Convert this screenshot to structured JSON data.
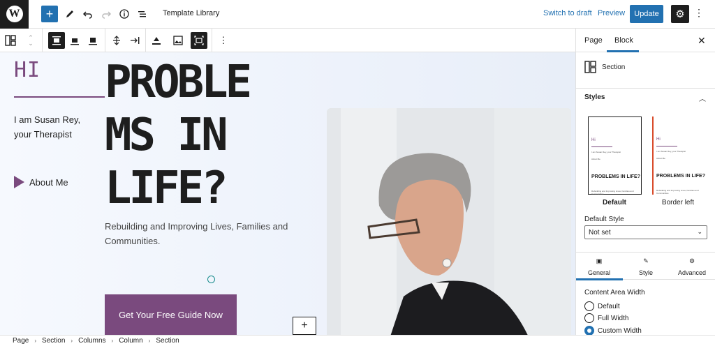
{
  "topbar": {
    "title": "Template Library",
    "switch_to_draft": "Switch to draft",
    "preview": "Preview",
    "update": "Update"
  },
  "canvas": {
    "hi": "HI",
    "intro": "I am Susan Rey,  your Therapist",
    "about_link": "About Me",
    "headline_lines": [
      "PROBLE",
      "MS IN",
      "LIFE?"
    ],
    "subline": "Rebuilding and Improving Lives, Families and Communities.",
    "cta": "Get Your Free Guide Now"
  },
  "sidebar": {
    "tabs": [
      "Page",
      "Block"
    ],
    "active_tab": "Block",
    "block_name": "Section",
    "styles_title": "Styles",
    "style_options": [
      {
        "label": "Default",
        "selected": true
      },
      {
        "label": "Border left",
        "selected": false
      }
    ],
    "preview_hi": "Hi",
    "preview_text": "I am Susan Rey, your Therapist",
    "preview_about": "About Me",
    "preview_heading": "PROBLEMS IN LIFE?",
    "preview_sub": "Rebuilding and Improving Lives, Families and Communities",
    "default_style_label": "Default Style",
    "default_style_value": "Not set",
    "settings_tabs": [
      "General",
      "Style",
      "Advanced"
    ],
    "active_settings_tab": "General",
    "content_area_width_label": "Content Area Width",
    "width_options": [
      {
        "label": "Default",
        "checked": false
      },
      {
        "label": "Full Width",
        "checked": false
      },
      {
        "label": "Custom Width",
        "checked": true
      }
    ]
  },
  "breadcrumb": [
    "Page",
    "Section",
    "Columns",
    "Column",
    "Section"
  ],
  "colors": {
    "accent": "#2271b1",
    "brand_purple": "#7a4a7e",
    "dark": "#1e1e1e"
  }
}
